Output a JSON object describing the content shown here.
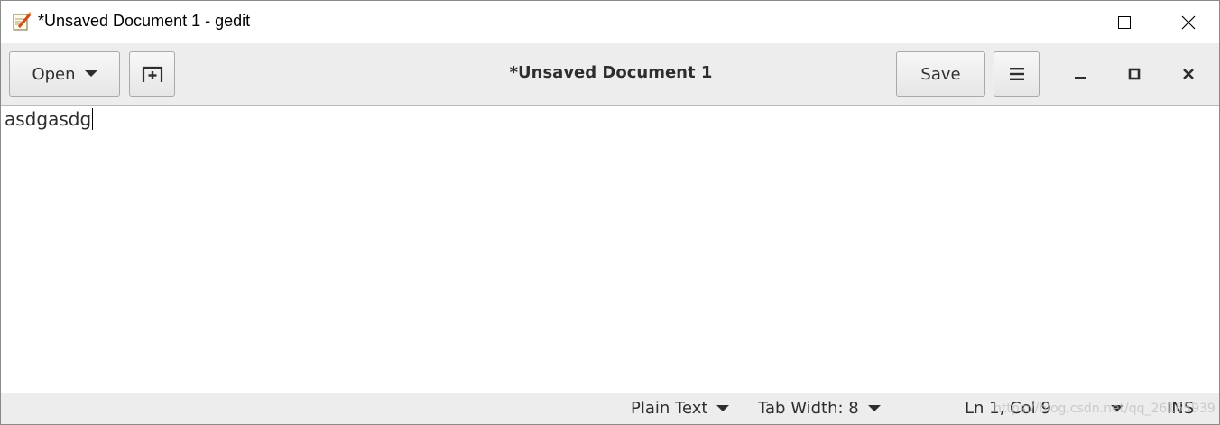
{
  "window": {
    "title": "*Unsaved Document 1 - gedit"
  },
  "header": {
    "open_label": "Open",
    "doc_title": "*Unsaved Document 1",
    "save_label": "Save"
  },
  "editor": {
    "content": "asdgasdg"
  },
  "statusbar": {
    "language": "Plain Text",
    "tab_width": "Tab Width: 8",
    "position": "Ln 1, Col 9",
    "mode": "INS"
  },
  "watermark": "https://blog.csdn.net/qq_26165939",
  "icons": {
    "app": "gedit-notepad-icon",
    "new_tab": "new-tab-icon",
    "menu": "hamburger-menu-icon"
  }
}
